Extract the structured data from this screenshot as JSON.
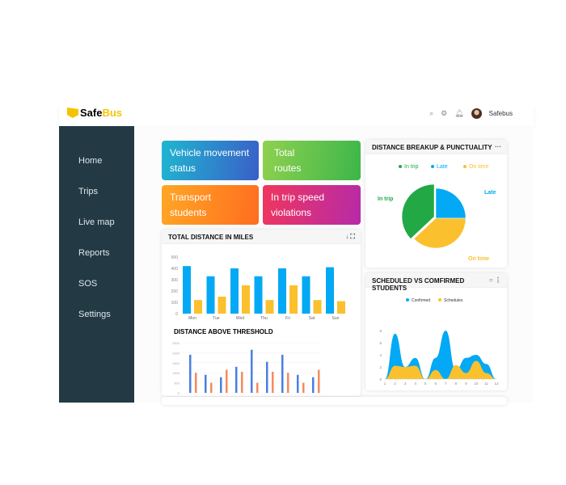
{
  "header": {
    "brand_a": "Safe",
    "brand_b": "Bus",
    "user": "Safebus",
    "icons": [
      "search-icon",
      "gear-icon",
      "bell-icon"
    ]
  },
  "sidebar": {
    "items": [
      "Home",
      "Trips",
      "Live map",
      "Reports",
      "SOS",
      "Settings"
    ]
  },
  "tiles": [
    {
      "label": "Vehicle movement status",
      "from": "#1fb6d0",
      "to": "#3a5fc8"
    },
    {
      "label": "Total routes",
      "from": "#8fd14f",
      "to": "#3cb64a"
    },
    {
      "label": "Transport students",
      "from": "#ffa726",
      "to": "#ff6d1f"
    },
    {
      "label": "In trip speed violations",
      "from": "#f0365e",
      "to": "#b62aa8"
    }
  ],
  "distance_card": {
    "title": "TOTAL DISTANCE IN MILES",
    "threshold_title": "DISTANCE ABOVE THRESHOLD"
  },
  "pie_card": {
    "title": "DISTANCE BREAKUP & PUNCTUALITY"
  },
  "area_card": {
    "title": "SCHEDULED VS COMFIRMED STUDENTS"
  },
  "chart_data": [
    {
      "type": "bar",
      "categories": [
        "Mon",
        "Tue",
        "Wed",
        "Thu",
        "Fri",
        "Sat",
        "Sun"
      ],
      "ylim": [
        0,
        500
      ],
      "yticks": [
        0,
        100,
        200,
        300,
        400,
        500
      ],
      "series": [
        {
          "values": [
            420,
            330,
            400,
            330,
            400,
            330,
            410
          ],
          "color": "#03a9f4"
        },
        {
          "values": [
            120,
            150,
            250,
            120,
            250,
            120,
            110
          ],
          "color": "#fbc02d"
        }
      ]
    },
    {
      "type": "bar",
      "ylim": [
        0,
        2500
      ],
      "yticks": [
        0,
        500,
        1000,
        1500,
        2000,
        2500
      ],
      "series": [
        {
          "values": [
            1900,
            900,
            780,
            1300,
            2150,
            1550,
            1900,
            900,
            780
          ],
          "color": "#4a7fe0"
        },
        {
          "values": [
            1000,
            500,
            1150,
            1050,
            500,
            1050,
            1000,
            500,
            1150
          ],
          "color": "#f58a5c"
        }
      ]
    },
    {
      "type": "pie",
      "labels": [
        "In trip",
        "Late",
        "On time"
      ],
      "values": [
        37,
        25,
        38
      ],
      "colors": [
        "#22a845",
        "#03a9f4",
        "#fbc02d"
      ],
      "legend": "top"
    },
    {
      "type": "area",
      "x": [
        1,
        2,
        3,
        4,
        5,
        6,
        7,
        8,
        9,
        10,
        11,
        12
      ],
      "ylim": [
        0,
        8
      ],
      "yticks": [
        0,
        2,
        4,
        6,
        8
      ],
      "legend": "top",
      "series": [
        {
          "name": "Confirmed",
          "values": [
            0,
            7.5,
            2,
            3.5,
            0,
            3.5,
            8,
            1.5,
            3.5,
            4,
            2.5,
            0
          ],
          "color": "#03a9f4"
        },
        {
          "name": "Schedules",
          "values": [
            0,
            2.2,
            2,
            2.2,
            0,
            1.5,
            0,
            2.3,
            1,
            3,
            1,
            0
          ],
          "color": "#fbc02d"
        }
      ]
    }
  ]
}
